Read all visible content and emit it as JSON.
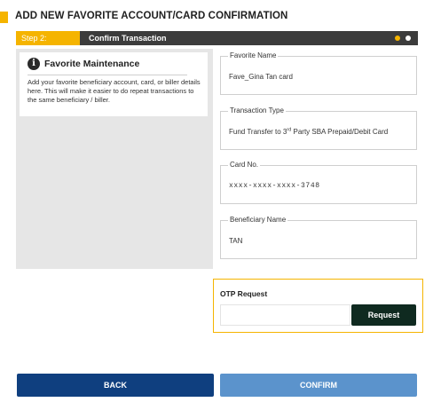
{
  "page": {
    "title": "ADD NEW FAVORITE ACCOUNT/CARD CONFIRMATION"
  },
  "step": {
    "label": "Step 2:",
    "title": "Confirm Transaction",
    "total_dots": 2,
    "current": 1
  },
  "info": {
    "icon": "info-icon",
    "icon_glyph": "i",
    "title": "Favorite Maintenance",
    "text": "Add your favorite beneficiary account, card, or biller details here. This will make it easier to do repeat transactions to the same beneficiary / biller."
  },
  "fields": {
    "favorite_name": {
      "label": "Favorite Name",
      "value": "Fave_Gina Tan card"
    },
    "transaction_type": {
      "label": "Transaction Type",
      "value_prefix": "Fund Transfer to 3",
      "value_sup": "rd",
      "value_suffix": " Party SBA Prepaid/Debit Card"
    },
    "card_no": {
      "label": "Card No.",
      "value": "xxxx-xxxx-xxxx-3748"
    },
    "beneficiary_name": {
      "label": "Beneficiary Name",
      "value": "TAN"
    }
  },
  "otp": {
    "title": "OTP Request",
    "input_value": "",
    "request_label": "Request"
  },
  "actions": {
    "back_label": "BACK",
    "confirm_label": "CONFIRM"
  },
  "colors": {
    "accent": "#f5b400",
    "step_bar": "#3c3c3c",
    "back_button": "#0f3f7f",
    "confirm_button": "#5b93cc",
    "request_button": "#0f2a20"
  }
}
